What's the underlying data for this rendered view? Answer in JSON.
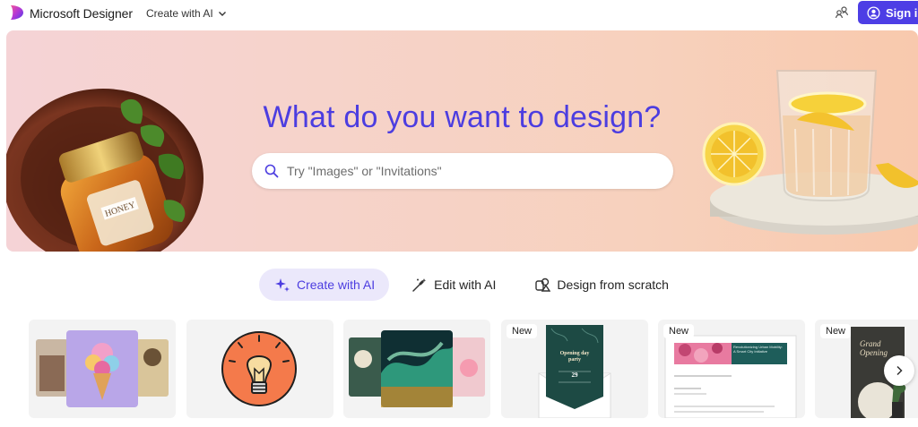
{
  "header": {
    "app_title": "Microsoft Designer",
    "create_menu_label": "Create with AI",
    "signin_label": "Sign in",
    "brand_color": "#4d3ee5"
  },
  "hero": {
    "title": "What do you want to design?",
    "search_placeholder": "Try \"Images\" or \"Invitations\"",
    "title_color": "#4c3de0"
  },
  "tabs": [
    {
      "label": "Create with AI",
      "icon": "sparkle-icon",
      "selected": true
    },
    {
      "label": "Edit with AI",
      "icon": "magic-wand-icon",
      "selected": false
    },
    {
      "label": "Design from scratch",
      "icon": "shapes-icon",
      "selected": false
    }
  ],
  "cards": [
    {
      "badge": "",
      "name": "image-creator"
    },
    {
      "badge": "",
      "name": "sticker-creator"
    },
    {
      "badge": "",
      "name": "wallpaper-creator"
    },
    {
      "badge": "New",
      "name": "invitation-creator",
      "preview_title": "Opening day party",
      "preview_day": "29"
    },
    {
      "badge": "New",
      "name": "newsletter-creator",
      "preview_title": "Revolutionizing Urban Mobility: A Smart City Initiative"
    },
    {
      "badge": "New",
      "name": "poster-creator",
      "preview_title": "Grand Opening"
    }
  ],
  "icons": {
    "logo": "designer-logo-icon",
    "create_chevron": "chevron-down-icon",
    "share": "share-people-icon",
    "signin": "user-circle-icon",
    "search": "search-icon",
    "carousel_next": "chevron-right-icon"
  }
}
